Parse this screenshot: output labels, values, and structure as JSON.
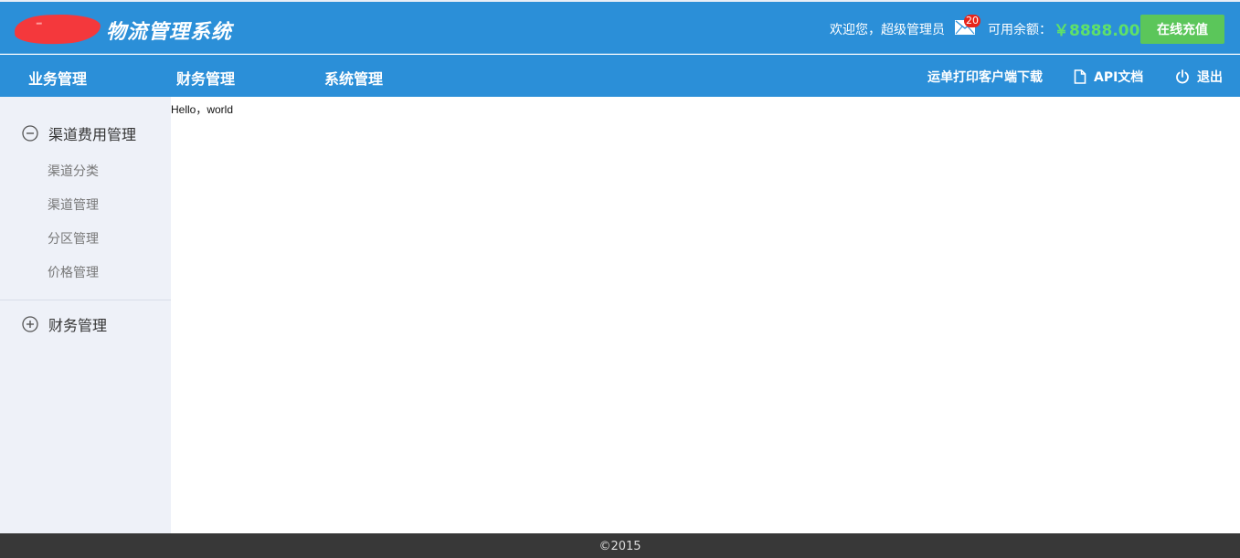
{
  "header": {
    "logo_icon": "logo-redacted",
    "title": "物流管理系统",
    "welcome": "欢迎您，超级管理员",
    "mail_icon": "envelope-icon",
    "mail_count": "20",
    "balance_label": "可用余额：",
    "balance_value": "￥8888.00",
    "recharge_label": "在线充值"
  },
  "nav": {
    "items": [
      {
        "label": "业务管理"
      },
      {
        "label": "财务管理"
      },
      {
        "label": "系统管理"
      }
    ],
    "right": {
      "download_label": "运单打印客户端下载",
      "api_label": "API文档",
      "api_icon": "document-icon",
      "logout_label": "退出",
      "logout_icon": "power-icon"
    }
  },
  "sidebar": {
    "groups": [
      {
        "label": "渠道费用管理",
        "icon": "minus-circle-icon",
        "expanded": true,
        "items": [
          {
            "label": "渠道分类"
          },
          {
            "label": "渠道管理"
          },
          {
            "label": "分区管理"
          },
          {
            "label": "价格管理"
          }
        ]
      },
      {
        "label": "财务管理",
        "icon": "plus-circle-icon",
        "expanded": false,
        "items": []
      }
    ]
  },
  "content": {
    "text": "Hello，world"
  },
  "footer": {
    "copyright": "©2015"
  },
  "colors": {
    "primary": "#2b8fd8",
    "recharge": "#5bc65a",
    "balance": "#5fe06a",
    "badge": "#e8241a",
    "sidebar_bg": "#eef1f8",
    "footer_bg": "#383838"
  }
}
